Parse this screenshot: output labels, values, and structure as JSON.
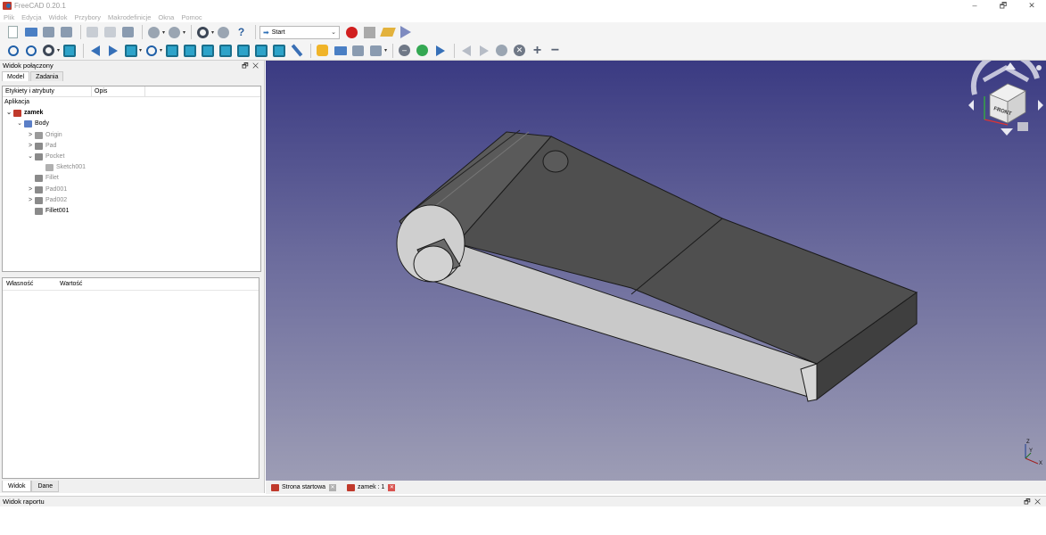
{
  "window": {
    "title": "FreeCAD 0.20.1",
    "minimize": "–",
    "restore": "🗗",
    "close": "✕"
  },
  "menu": [
    "Plik",
    "Edycja",
    "Widok",
    "Przybory",
    "Makrodefinicje",
    "Okna",
    "Pomoc"
  ],
  "toolbar": {
    "workbench": "Start"
  },
  "left_panel": {
    "title": "Widok połączony",
    "tabs": [
      "Model",
      "Zadania"
    ],
    "tree_columns": [
      "Etykiety i atrybuty",
      "Opis"
    ],
    "tree": [
      {
        "label": "Aplikacja",
        "level": 0,
        "expander": "",
        "icon": "",
        "style": ""
      },
      {
        "label": "zamek",
        "level": 0,
        "expander": "⌄",
        "icon": "document-icon",
        "style": "bold"
      },
      {
        "label": "Body",
        "level": 1,
        "expander": "⌄",
        "icon": "body-icon",
        "style": ""
      },
      {
        "label": "Origin",
        "level": 2,
        "expander": ">",
        "icon": "origin-icon",
        "style": "dim"
      },
      {
        "label": "Pad",
        "level": 2,
        "expander": ">",
        "icon": "pad-icon",
        "style": "dim"
      },
      {
        "label": "Pocket",
        "level": 2,
        "expander": "⌄",
        "icon": "pocket-icon",
        "style": "dim"
      },
      {
        "label": "Sketch001",
        "level": 3,
        "expander": "",
        "icon": "sketch-icon",
        "style": "dim"
      },
      {
        "label": "Fillet",
        "level": 2,
        "expander": "",
        "icon": "fillet-icon",
        "style": "dim"
      },
      {
        "label": "Pad001",
        "level": 2,
        "expander": ">",
        "icon": "pad-icon",
        "style": "dim"
      },
      {
        "label": "Pad002",
        "level": 2,
        "expander": ">",
        "icon": "pad-icon",
        "style": "dim"
      },
      {
        "label": "Fillet001",
        "level": 2,
        "expander": "",
        "icon": "fillet-icon",
        "style": ""
      }
    ],
    "prop_columns": [
      "Własność",
      "Wartość"
    ],
    "bottom_tabs": [
      "Widok",
      "Dane"
    ]
  },
  "navcube": {
    "face_label": "FRONT"
  },
  "axis": {
    "z": "Z",
    "y": "Y",
    "x": "X"
  },
  "doc_tabs": [
    {
      "label": "Strona startowa",
      "close": "✕"
    },
    {
      "label": "zamek : 1",
      "close": "✕"
    }
  ],
  "report": {
    "title": "Widok raportu"
  },
  "colors": {
    "viewport_top": "#3a3a82",
    "viewport_bottom": "#9d9db5",
    "model_face": "#c8c8c8",
    "model_dark": "#4f4f4f"
  }
}
